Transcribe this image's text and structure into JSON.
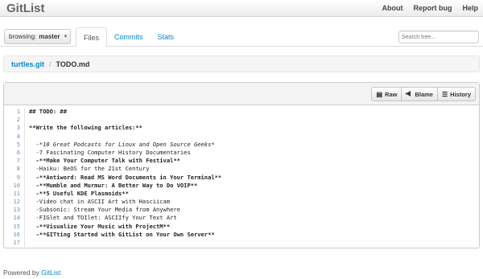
{
  "navbar": {
    "brand": "GitList",
    "links": [
      "About",
      "Report bug",
      "Help"
    ]
  },
  "toolbar": {
    "branch_prefix": "browsing:",
    "branch": "master",
    "tabs": [
      {
        "label": "Files",
        "active": true
      },
      {
        "label": "Commits",
        "active": false
      },
      {
        "label": "Stats",
        "active": false
      }
    ],
    "search_placeholder": "Search tree..."
  },
  "breadcrumb": {
    "repo": "turtles.git",
    "separator": "/",
    "file": "TODO.md"
  },
  "file_actions": [
    {
      "label": "Raw",
      "icon": "file-icon"
    },
    {
      "label": "Blame",
      "icon": "megaphone-icon"
    },
    {
      "label": "History",
      "icon": "list-icon"
    }
  ],
  "code_lines": [
    {
      "n": "1",
      "text": "## TODO: ##",
      "style": "b"
    },
    {
      "n": "2",
      "text": "",
      "style": ""
    },
    {
      "n": "3",
      "text": "**Write the following articles:**",
      "style": "b"
    },
    {
      "n": "4",
      "text": "",
      "style": ""
    },
    {
      "n": "5",
      "text": "  -*10 Great Podcasts for Linux and Open Source Geeks*",
      "style": "i"
    },
    {
      "n": "6",
      "text": "  -7 Fascinating Computer History Documentaries",
      "style": ""
    },
    {
      "n": "7",
      "text": "  -**Make Your Computer Talk with Festival**",
      "style": "b"
    },
    {
      "n": "8",
      "text": "  -Haiku: BeOS for the 21st Century",
      "style": ""
    },
    {
      "n": "9",
      "text": "  -**Antiword: Read MS Word Documents in Your Terminal**",
      "style": "b"
    },
    {
      "n": "10",
      "text": "  -**Mumble and Murmur: A Better Way to Do VOIP**",
      "style": "b"
    },
    {
      "n": "11",
      "text": "  -**5 Useful KDE Plasmoids**",
      "style": "b"
    },
    {
      "n": "12",
      "text": "  -Video chat in ASCII Art with Hasciicam",
      "style": ""
    },
    {
      "n": "13",
      "text": "  -Subsonic: Stream Your Media from Anywhere",
      "style": ""
    },
    {
      "n": "14",
      "text": "  -FIGlet and TOIlet: ASCIIfy Your Text Art",
      "style": ""
    },
    {
      "n": "15",
      "text": "  -**Visualize Your Music with ProjectM**",
      "style": "b"
    },
    {
      "n": "16",
      "text": "  -**GITting Started with GitList on Your Own Server**",
      "style": "b"
    },
    {
      "n": "17",
      "text": "",
      "style": ""
    }
  ],
  "footer": {
    "prefix": "Powered by",
    "link": "GitList"
  }
}
